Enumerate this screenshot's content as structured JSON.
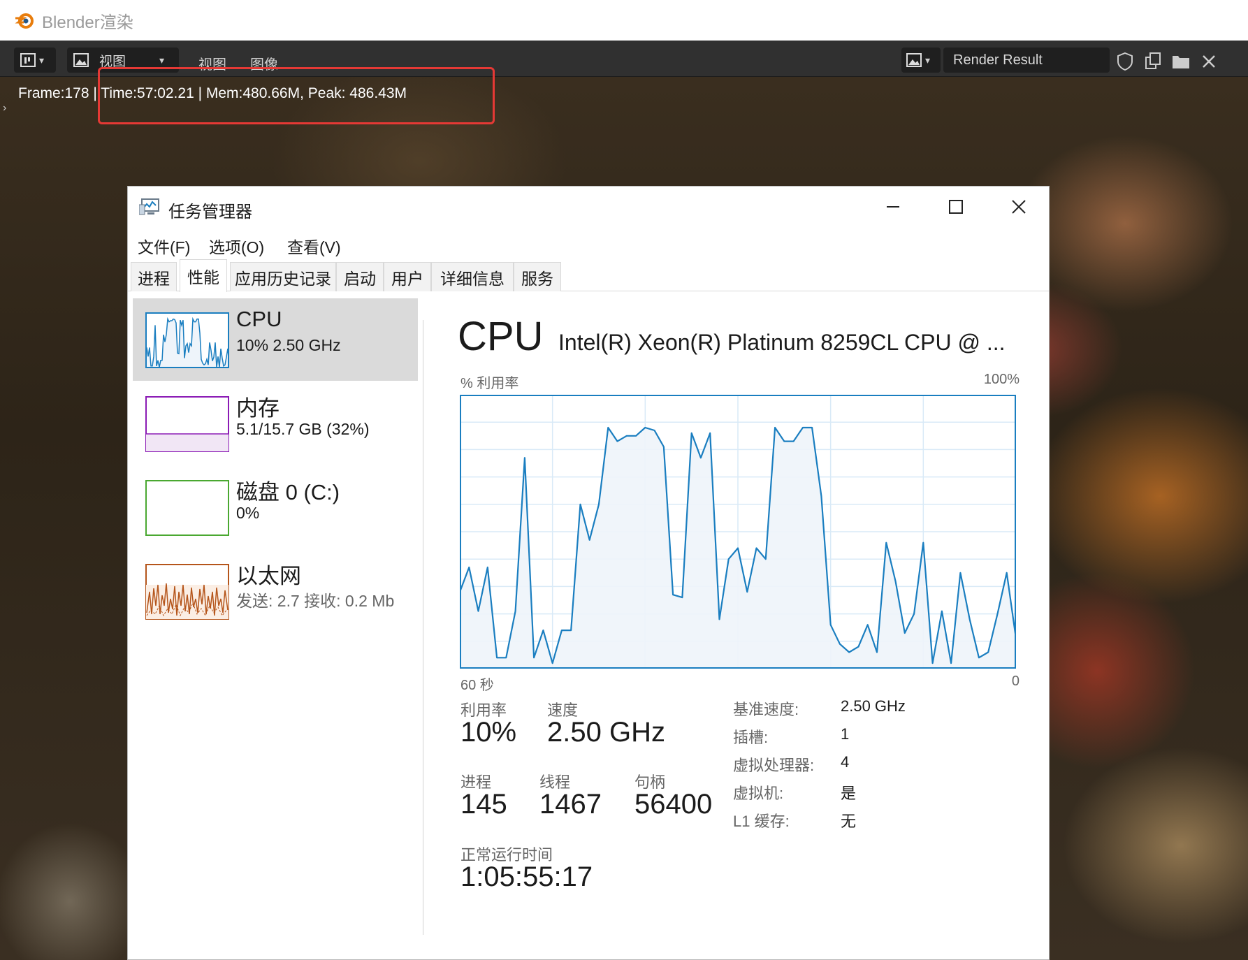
{
  "blender": {
    "window_title": "Blender渲染",
    "toolbar": {
      "view_menu_1": "视图",
      "view_menu_2": "视图",
      "image_menu": "图像",
      "render_slot": "Render Result"
    },
    "render_info": "Frame:178 | Time:57:02.21 | Mem:480.66M, Peak: 486.43M"
  },
  "task_manager": {
    "title": "任务管理器",
    "window_buttons": {
      "minimize": "—",
      "maximize": "☐",
      "close": "✕"
    },
    "menus": [
      "文件(F)",
      "选项(O)",
      "查看(V)"
    ],
    "tabs": [
      "进程",
      "性能",
      "应用历史记录",
      "启动",
      "用户",
      "详细信息",
      "服务"
    ],
    "active_tab": "性能",
    "sidebar": [
      {
        "title": "CPU",
        "sub": "10%  2.50 GHz",
        "color": "#1a7ec0",
        "selected": true
      },
      {
        "title": "内存",
        "sub": "5.1/15.7 GB (32%)",
        "color": "#8b1bb5",
        "selected": false
      },
      {
        "title": "磁盘 0 (C:)",
        "sub": "0%",
        "color": "#4aa831",
        "selected": false
      },
      {
        "title": "以太网",
        "sub": "发送: 2.7  接收: 0.2 Mb",
        "color": "#b5551b",
        "selected": false
      }
    ],
    "cpu": {
      "heading": "CPU",
      "model": "Intel(R) Xeon(R) Platinum 8259CL CPU @ ...",
      "graph_label": "% 利用率",
      "graph_max": "100%",
      "x_left": "60 秒",
      "x_right": "0",
      "stats": {
        "util_label": "利用率",
        "util_value": "10%",
        "speed_label": "速度",
        "speed_value": "2.50 GHz",
        "proc_label": "进程",
        "proc_value": "145",
        "thread_label": "线程",
        "thread_value": "1467",
        "handle_label": "句柄",
        "handle_value": "56400",
        "uptime_label": "正常运行时间",
        "uptime_value": "1:05:55:17"
      },
      "details": [
        {
          "label": "基准速度:",
          "value": "2.50 GHz"
        },
        {
          "label": "插槽:",
          "value": "1"
        },
        {
          "label": "虚拟处理器:",
          "value": "4"
        },
        {
          "label": "虚拟机:",
          "value": "是"
        },
        {
          "label": "L1 缓存:",
          "value": "无"
        }
      ]
    }
  },
  "chart_data": {
    "type": "area",
    "xlabel": "60 秒",
    "ylabel": "% 利用率",
    "ylim": [
      0,
      100
    ],
    "line_color": "#1a7ec0",
    "fill_color": "#eef4fa",
    "grid": true,
    "values": [
      28,
      37,
      21,
      37,
      4,
      4,
      21,
      77,
      4,
      14,
      2,
      14,
      14,
      60,
      47,
      60,
      88,
      83,
      85,
      85,
      88,
      87,
      81,
      27,
      26,
      86,
      77,
      86,
      18,
      40,
      44,
      28,
      44,
      40,
      88,
      83,
      83,
      88,
      88,
      63,
      16,
      9,
      6,
      8,
      16,
      6,
      46,
      32,
      13,
      20,
      46,
      2,
      21,
      2,
      35,
      18,
      4,
      6,
      20,
      35,
      11
    ]
  }
}
